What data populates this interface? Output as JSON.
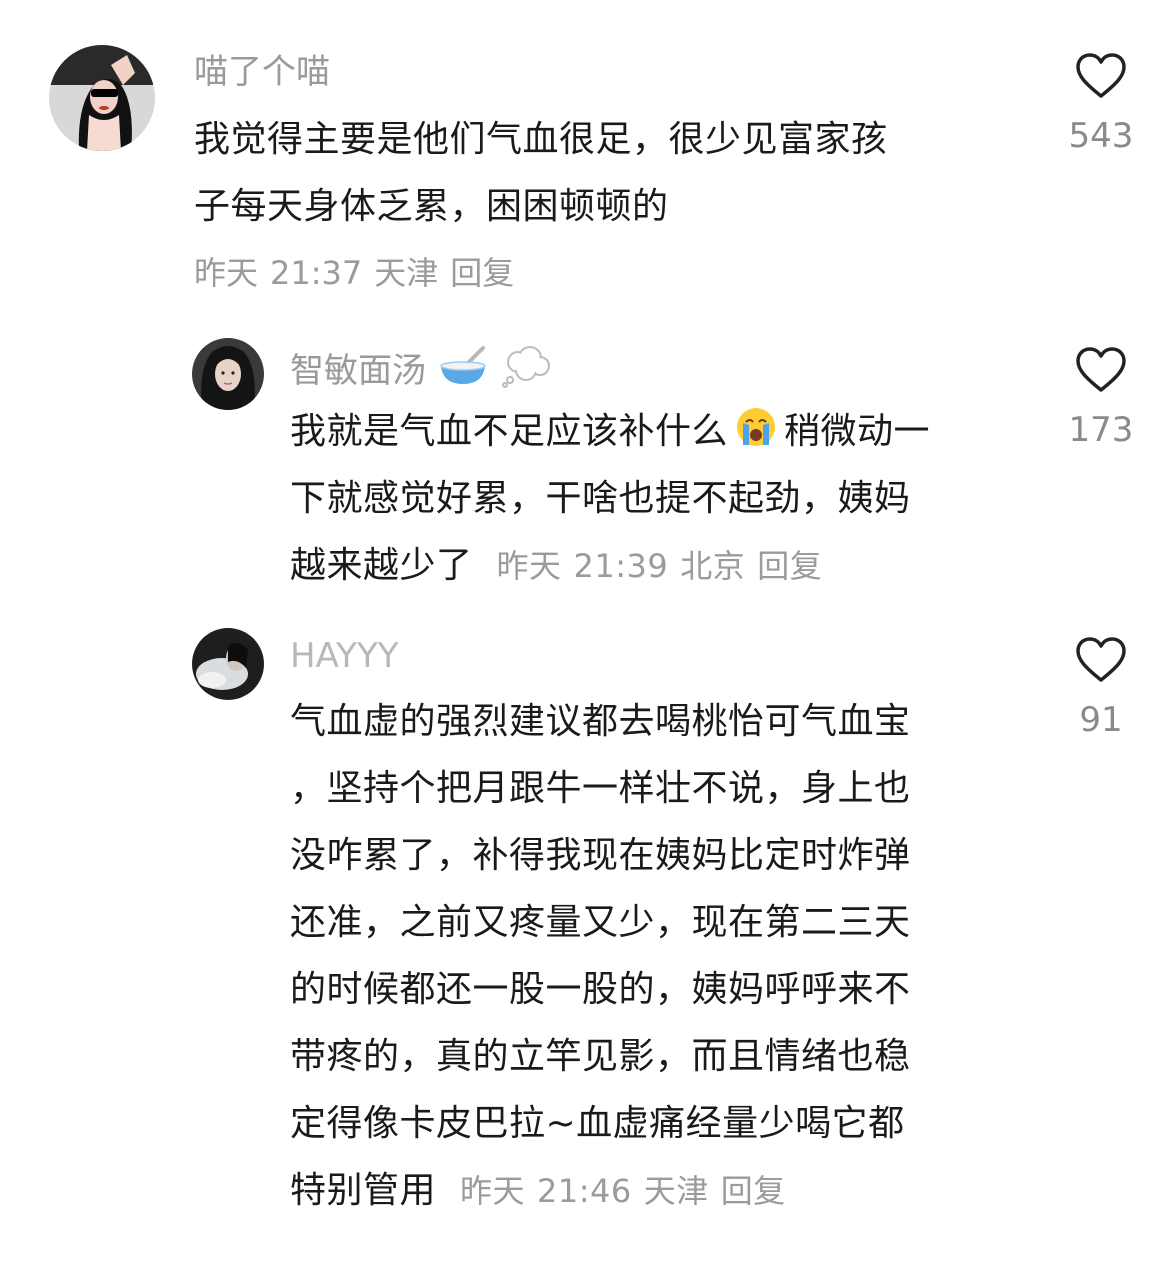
{
  "comments": [
    {
      "username": "喵了个喵",
      "lines": [
        "我觉得主要是他们气血很足，很少见富家孩",
        "子每天身体乏累，困困顿顿的"
      ],
      "meta": {
        "date": "昨天",
        "time": "21:37",
        "location": "天津",
        "reply": "回复"
      },
      "likes": "543"
    },
    {
      "username": "智敏面汤",
      "username_emojis": [
        "bowl-with-spoon-emoji",
        "thought-bubble-emoji"
      ],
      "lines": [
        "我就是气血不足应该补什么",
        "稍微动一",
        "下就感觉好累，干啥也提不起劲，姨妈",
        "越来越少了"
      ],
      "inline_emoji": "loudly-crying-face-emoji",
      "meta": {
        "date": "昨天",
        "time": "21:39",
        "location": "北京",
        "reply": "回复"
      },
      "likes": "173"
    },
    {
      "username": "HAYYY",
      "lines": [
        "气血虚的强烈建议都去喝桃怡可气血宝",
        "，坚持个把月跟牛一样壮不说，身上也",
        "没咋累了，补得我现在姨妈比定时炸弹",
        "还准，之前又疼量又少，现在第二三天",
        "的时候都还一股一股的，姨妈呼呼来不",
        "带疼的，真的立竿见影，而且情绪也稳",
        "定得像卡皮巴拉~血虚痛经量少喝它都",
        "特别管用"
      ],
      "meta": {
        "date": "昨天",
        "time": "21:46",
        "location": "天津",
        "reply": "回复"
      },
      "likes": "91"
    }
  ],
  "icons": {
    "like": "heart-outline-icon"
  }
}
